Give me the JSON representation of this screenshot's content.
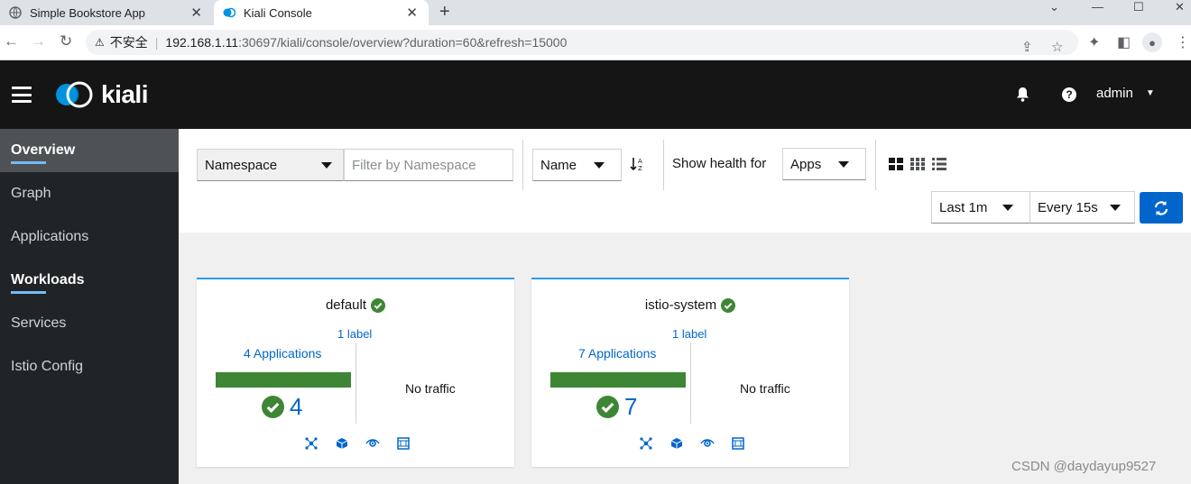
{
  "browser": {
    "tabs": [
      {
        "title": "Simple Bookstore App",
        "active": false
      },
      {
        "title": "Kiali Console",
        "active": true
      }
    ],
    "security_label": "不安全",
    "url_host": "192.168.1.11",
    "url_rest": ":30697/kiali/console/overview?duration=60&refresh=15000"
  },
  "masthead": {
    "logo_text": "kiali",
    "user": "admin"
  },
  "sidebar": {
    "items": [
      {
        "label": "Overview"
      },
      {
        "label": "Graph"
      },
      {
        "label": "Applications"
      },
      {
        "label": "Workloads"
      },
      {
        "label": "Services"
      },
      {
        "label": "Istio Config"
      }
    ]
  },
  "toolbar": {
    "filter_type": "Namespace",
    "filter_placeholder": "Filter by Namespace",
    "sort_by": "Name",
    "health_label": "Show health for",
    "health_value": "Apps",
    "duration": "Last 1m",
    "refresh": "Every 15s"
  },
  "cards": [
    {
      "name": "default",
      "labels": "1 label",
      "apps": "4 Applications",
      "count": "4",
      "traffic": "No traffic"
    },
    {
      "name": "istio-system",
      "labels": "1 label",
      "apps": "7 Applications",
      "count": "7",
      "traffic": "No traffic"
    }
  ],
  "watermark": "CSDN @daydayup9527",
  "colors": {
    "masthead": "#151515",
    "sidebar": "#212427",
    "accent": "#0066cc",
    "healthy": "#3e8635"
  }
}
